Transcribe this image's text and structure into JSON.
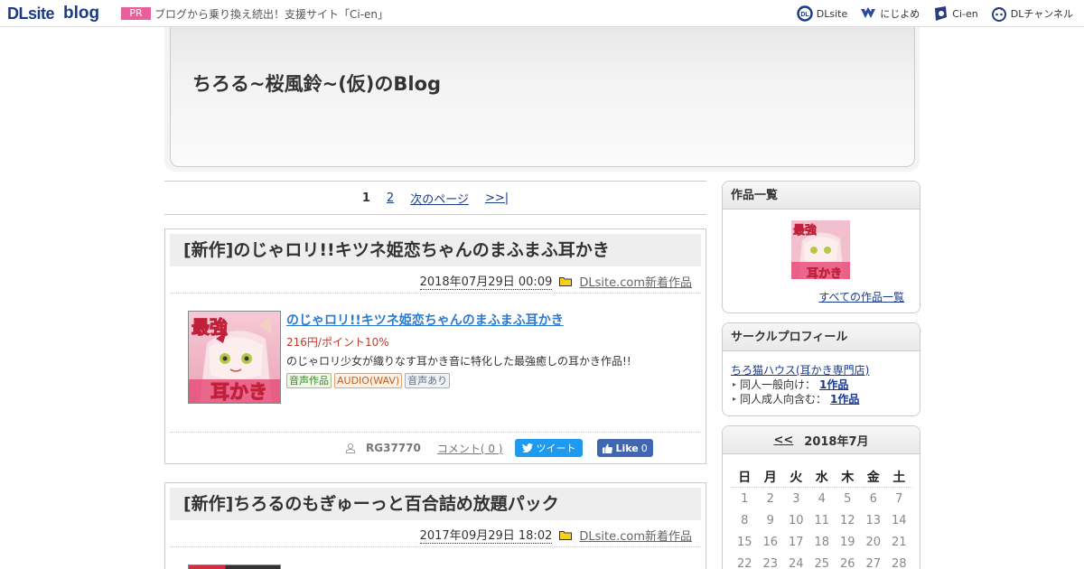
{
  "topbar": {
    "logo_dl": "DLsite",
    "logo_blog": "blog",
    "pr_badge": "PR",
    "pr_text": "ブログから乗り換え続出！支援サイト「Ci-en」",
    "links": [
      {
        "label": "DLsite",
        "icon": "dlsite-icon"
      },
      {
        "label": "にじよめ",
        "icon": "nijiyome-icon"
      },
      {
        "label": "Ci-en",
        "icon": "ci-en-icon"
      },
      {
        "label": "DLチャンネル",
        "icon": "dlchannel-icon"
      }
    ]
  },
  "header": {
    "title": "ちろる~桜風鈴~(仮)のBlog"
  },
  "pager": {
    "current": "1",
    "page2": "2",
    "next": "次のページ",
    "last": ">>|"
  },
  "entries": [
    {
      "title": "[新作]のじゃロリ!!キツネ姫恋ちゃんのまふまふ耳かき",
      "date": "2018年07月29日 00:09",
      "category": "DLsite.com新着作品",
      "work_title": "のじゃロリ!!キツネ姫恋ちゃんのまふまふ耳かき",
      "price": "216円/ポイント10%",
      "description": "のじゃロリ少女が織りなす耳かき音に特化した最強癒しの耳かき作品!!",
      "tags": [
        "音声作品",
        "AUDIO(WAV)",
        "音声あり"
      ],
      "thumb_text_top": "最強",
      "thumb_text_bottom": "耳かき",
      "author": "RG37770",
      "comment": "コメント( 0 )",
      "tweet": "ツイート",
      "like": "Like",
      "like_count": "0"
    },
    {
      "title": "[新作]ちろるのもぎゅーっと百合詰め放題パック",
      "date": "2017年09月29日 18:02",
      "category": "DLsite.com新着作品"
    }
  ],
  "sidebar": {
    "works": {
      "heading": "作品一覧",
      "thumb_text_top": "最強",
      "thumb_text_bottom": "耳かき",
      "all_link": "すべての作品一覧"
    },
    "profile": {
      "heading": "サークルプロフィール",
      "circle_name": "ちろ猫ハウス(耳かき専門店)",
      "general_label": "同人一般向け：",
      "general_count": "1作品",
      "adult_label": "同人成人向含む：",
      "adult_count": "1作品"
    },
    "calendar": {
      "prev": "<<",
      "month": "2018年7月",
      "dow": [
        "日",
        "月",
        "火",
        "水",
        "木",
        "金",
        "土"
      ],
      "weeks": [
        [
          "1",
          "2",
          "3",
          "4",
          "5",
          "6",
          "7"
        ],
        [
          "8",
          "9",
          "10",
          "11",
          "12",
          "13",
          "14"
        ],
        [
          "15",
          "16",
          "17",
          "18",
          "19",
          "20",
          "21"
        ],
        [
          "22",
          "23",
          "24",
          "25",
          "26",
          "27",
          "28"
        ]
      ]
    }
  },
  "colors": {
    "accent_link": "#1a3a8a",
    "work_link": "#2a7ad0",
    "price": "#c0392b",
    "pr": "#e8609a",
    "twitter": "#1d9bf0",
    "facebook": "#4267b2"
  }
}
